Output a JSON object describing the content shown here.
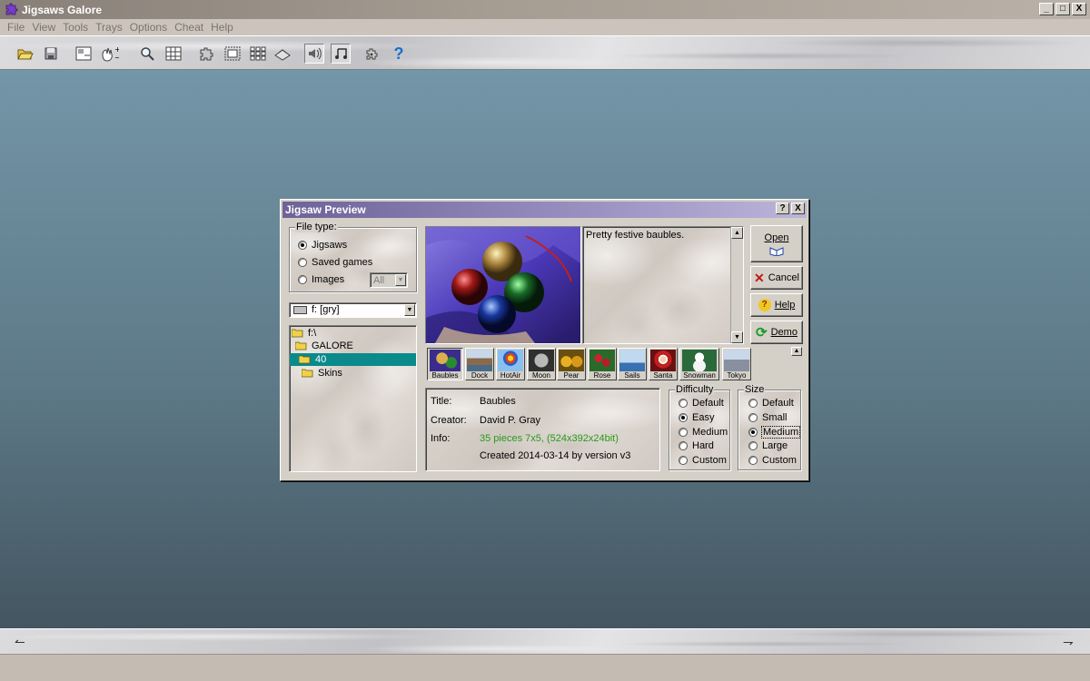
{
  "app": {
    "title": "Jigsaws Galore"
  },
  "window_controls": {
    "minimize": "_",
    "maximize": "□",
    "close": "X"
  },
  "menu": [
    {
      "label": "File"
    },
    {
      "label": "View"
    },
    {
      "label": "Tools"
    },
    {
      "label": "Trays"
    },
    {
      "label": "Options"
    },
    {
      "label": "Cheat"
    },
    {
      "label": "Help"
    }
  ],
  "toolbar": {
    "buttons": [
      {
        "icon": "open-folder-icon"
      },
      {
        "icon": "save-icon"
      },
      {
        "icon": "board-icon"
      },
      {
        "icon": "hand-zoom-icon"
      },
      {
        "icon": "magnifier-icon"
      },
      {
        "icon": "grid-icon"
      },
      {
        "icon": "puzzle-piece-icon"
      },
      {
        "icon": "frame-icon"
      },
      {
        "icon": "tiles-icon"
      },
      {
        "icon": "tray-icon"
      },
      {
        "icon": "sound-icon"
      },
      {
        "icon": "music-icon"
      },
      {
        "icon": "cheat-icon"
      },
      {
        "icon": "help-icon"
      }
    ],
    "help_glyph": "?"
  },
  "dialog": {
    "title": "Jigsaw Preview",
    "help_btn": "?",
    "close_btn": "X",
    "file_type": {
      "label": "File type:",
      "options": [
        "Jigsaws",
        "Saved games",
        "Images"
      ],
      "selected": "Jigsaws",
      "filter_value": "All"
    },
    "drive": {
      "value": "f: [gry]"
    },
    "folders": [
      "f:\\",
      "GALORE",
      "40",
      "Skins"
    ],
    "selected_folder": "40",
    "description": "Pretty festive baubles.",
    "buttons": {
      "open": "Open",
      "cancel": "Cancel",
      "help": "Help",
      "demo": "Demo"
    },
    "thumbnails": [
      "Baubles",
      "Dock",
      "HotAir",
      "Moon",
      "Pear",
      "Rose",
      "Sails",
      "Santa",
      "Snowman",
      "Tokyo"
    ],
    "selected_thumbnail": "Baubles",
    "info": {
      "title_label": "Title:",
      "title_value": "Baubles",
      "creator_label": "Creator:",
      "creator_value": "David P. Gray",
      "info_label": "Info:",
      "info_value": "35 pieces 7x5, (524x392x24bit)",
      "created": "Created 2014-03-14 by version v3",
      "info_color": "#2a9a1a"
    },
    "difficulty": {
      "label": "Difficulty",
      "options": [
        "Default",
        "Easy",
        "Medium",
        "Hard",
        "Custom"
      ],
      "selected": "Easy"
    },
    "size": {
      "label": "Size",
      "options": [
        "Default",
        "Small",
        "Medium",
        "Large",
        "Custom"
      ],
      "selected": "Medium"
    }
  },
  "colors": {
    "workspace_top": "#7396a8",
    "workspace_bottom": "#435661",
    "selection": "#0a8a8a",
    "dialog_title": "#6d6397"
  }
}
